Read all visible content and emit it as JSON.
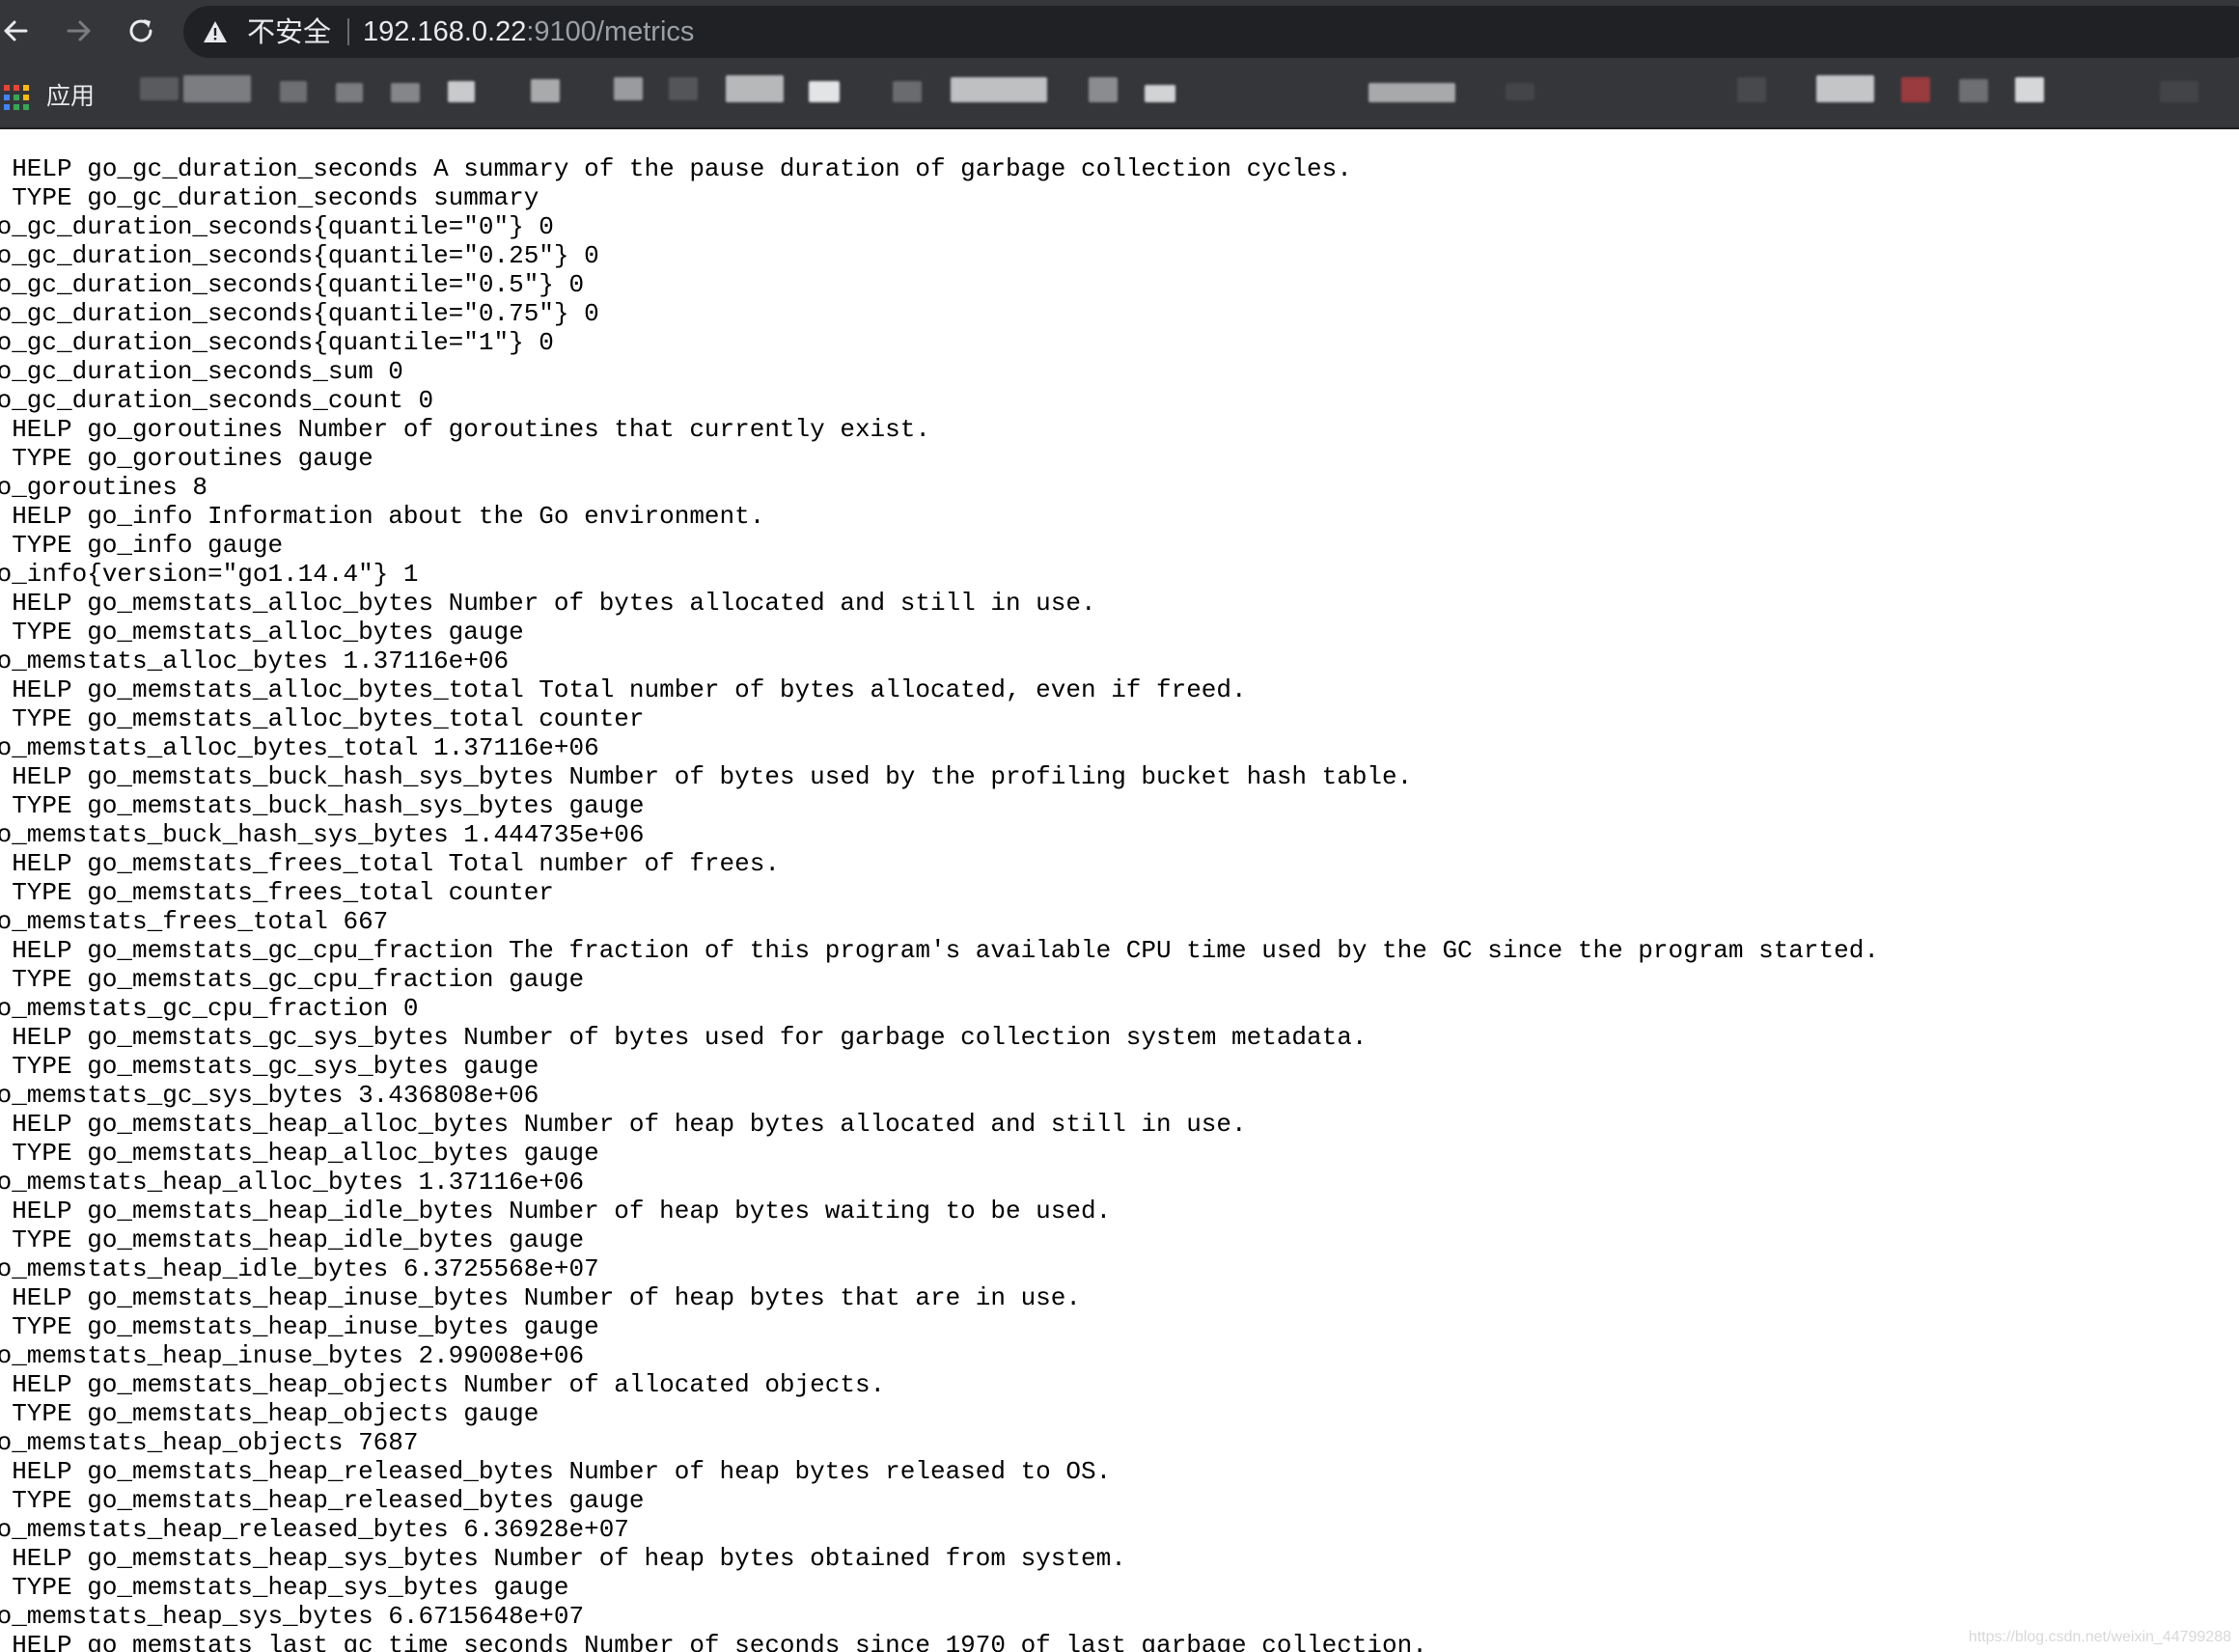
{
  "browser": {
    "security_label": "不安全",
    "url_host": "192.168.0.22",
    "url_rest": ":9100/metrics",
    "apps_label": "应用",
    "colors": {
      "chrome": "#35363a",
      "omnibox": "#202124",
      "text": "#e8eaed",
      "text_dim": "#9aa0a6"
    }
  },
  "metrics_text": "# HELP go_gc_duration_seconds A summary of the pause duration of garbage collection cycles.\n# TYPE go_gc_duration_seconds summary\ngo_gc_duration_seconds{quantile=\"0\"} 0\ngo_gc_duration_seconds{quantile=\"0.25\"} 0\ngo_gc_duration_seconds{quantile=\"0.5\"} 0\ngo_gc_duration_seconds{quantile=\"0.75\"} 0\ngo_gc_duration_seconds{quantile=\"1\"} 0\ngo_gc_duration_seconds_sum 0\ngo_gc_duration_seconds_count 0\n# HELP go_goroutines Number of goroutines that currently exist.\n# TYPE go_goroutines gauge\ngo_goroutines 8\n# HELP go_info Information about the Go environment.\n# TYPE go_info gauge\ngo_info{version=\"go1.14.4\"} 1\n# HELP go_memstats_alloc_bytes Number of bytes allocated and still in use.\n# TYPE go_memstats_alloc_bytes gauge\ngo_memstats_alloc_bytes 1.37116e+06\n# HELP go_memstats_alloc_bytes_total Total number of bytes allocated, even if freed.\n# TYPE go_memstats_alloc_bytes_total counter\ngo_memstats_alloc_bytes_total 1.37116e+06\n# HELP go_memstats_buck_hash_sys_bytes Number of bytes used by the profiling bucket hash table.\n# TYPE go_memstats_buck_hash_sys_bytes gauge\ngo_memstats_buck_hash_sys_bytes 1.444735e+06\n# HELP go_memstats_frees_total Total number of frees.\n# TYPE go_memstats_frees_total counter\ngo_memstats_frees_total 667\n# HELP go_memstats_gc_cpu_fraction The fraction of this program's available CPU time used by the GC since the program started.\n# TYPE go_memstats_gc_cpu_fraction gauge\ngo_memstats_gc_cpu_fraction 0\n# HELP go_memstats_gc_sys_bytes Number of bytes used for garbage collection system metadata.\n# TYPE go_memstats_gc_sys_bytes gauge\ngo_memstats_gc_sys_bytes 3.436808e+06\n# HELP go_memstats_heap_alloc_bytes Number of heap bytes allocated and still in use.\n# TYPE go_memstats_heap_alloc_bytes gauge\ngo_memstats_heap_alloc_bytes 1.37116e+06\n# HELP go_memstats_heap_idle_bytes Number of heap bytes waiting to be used.\n# TYPE go_memstats_heap_idle_bytes gauge\ngo_memstats_heap_idle_bytes 6.3725568e+07\n# HELP go_memstats_heap_inuse_bytes Number of heap bytes that are in use.\n# TYPE go_memstats_heap_inuse_bytes gauge\ngo_memstats_heap_inuse_bytes 2.99008e+06\n# HELP go_memstats_heap_objects Number of allocated objects.\n# TYPE go_memstats_heap_objects gauge\ngo_memstats_heap_objects 7687\n# HELP go_memstats_heap_released_bytes Number of heap bytes released to OS.\n# TYPE go_memstats_heap_released_bytes gauge\ngo_memstats_heap_released_bytes 6.36928e+07\n# HELP go_memstats_heap_sys_bytes Number of heap bytes obtained from system.\n# TYPE go_memstats_heap_sys_bytes gauge\ngo_memstats_heap_sys_bytes 6.6715648e+07\n# HELP go_memstats_last_gc_time_seconds Number of seconds since 1970 of last garbage collection.",
  "watermark": "https://blog.csdn.net/weixin_44799288"
}
